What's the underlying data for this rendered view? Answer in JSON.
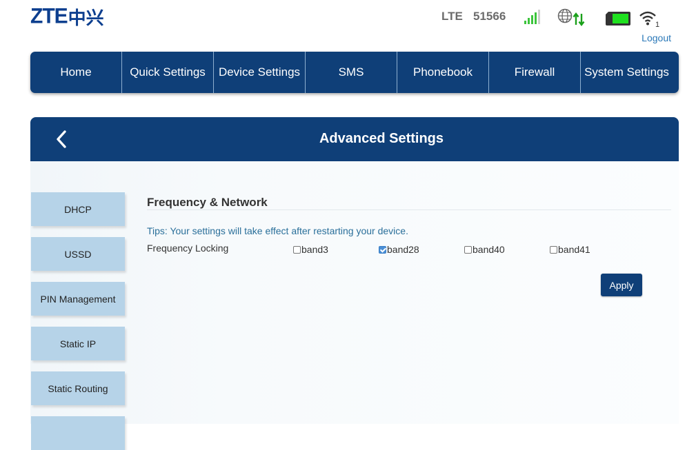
{
  "header": {
    "logo_latin": "ZTE",
    "logo_cn": "中兴",
    "network_type": "LTE",
    "operator": "51566",
    "wifi_clients": "1",
    "logout_label": "Logout"
  },
  "colors": {
    "primary": "#0f3f78",
    "side_menu": "#b6d3e8",
    "signal": "#3cc43c",
    "battery": "#1fe11f",
    "link": "#2a78b8"
  },
  "nav": {
    "items": [
      {
        "label": "Home"
      },
      {
        "label": "Quick Settings"
      },
      {
        "label": "Device Settings"
      },
      {
        "label": "SMS"
      },
      {
        "label": "Phonebook"
      },
      {
        "label": "Firewall"
      },
      {
        "label": "System Settings"
      }
    ]
  },
  "panel": {
    "title": "Advanced Settings"
  },
  "side_menu": {
    "items": [
      {
        "label": "DHCP"
      },
      {
        "label": "USSD"
      },
      {
        "label": "PIN Management"
      },
      {
        "label": "Static IP"
      },
      {
        "label": "Static Routing"
      },
      {
        "label": ""
      }
    ]
  },
  "content": {
    "section_title": "Frequency & Network",
    "tips": "Tips: Your settings will take effect after restarting your device.",
    "freq_label": "Frequency Locking",
    "bands": [
      {
        "label": "band3",
        "checked": false
      },
      {
        "label": "band28",
        "checked": true
      },
      {
        "label": "band40",
        "checked": false
      },
      {
        "label": "band41",
        "checked": false
      }
    ],
    "apply_label": "Apply"
  },
  "icons": {
    "signal": "signal-bars-icon",
    "globe": "globe-data-icon",
    "battery": "battery-icon",
    "wifi": "wifi-icon",
    "back": "chevron-left-icon"
  }
}
